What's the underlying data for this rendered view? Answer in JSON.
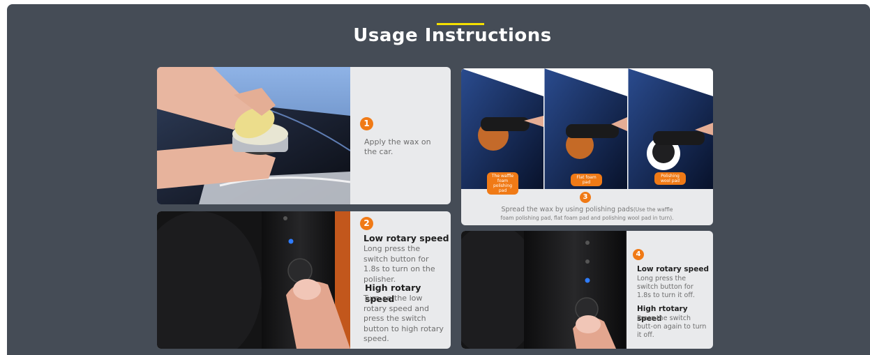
{
  "section": {
    "title": "Usage Instructions",
    "colors": {
      "background": "#454c56",
      "accent": "#f5e000",
      "badge": "#f07a16"
    }
  },
  "steps": [
    {
      "number": "1",
      "text": "Apply the wax on the car."
    },
    {
      "number": "2",
      "low_title": "Low rotary speed",
      "low_text": "Long press the switch button for 1.8s to turn on the polisher.",
      "high_title": "High rotary speed",
      "high_text": "Turn on the low rotary speed and press the switch button to high rotary speed."
    },
    {
      "number": "3",
      "pads": [
        "The waffle foam polishing pad",
        "Flat foam pad",
        "Polishing wool pad"
      ],
      "text_main": "Spread the wax by using polishing pads",
      "text_note": "(Use the waffle foam polishing pad, flat foam pad and polishing wool pad in turn)."
    },
    {
      "number": "4",
      "low_title": "Low rotary speed",
      "low_text": "Long press the switch button for 1.8s to turn it off.",
      "high_title": "High rtotary speed",
      "high_text": "Press the switch butt-on again to turn it off."
    }
  ]
}
